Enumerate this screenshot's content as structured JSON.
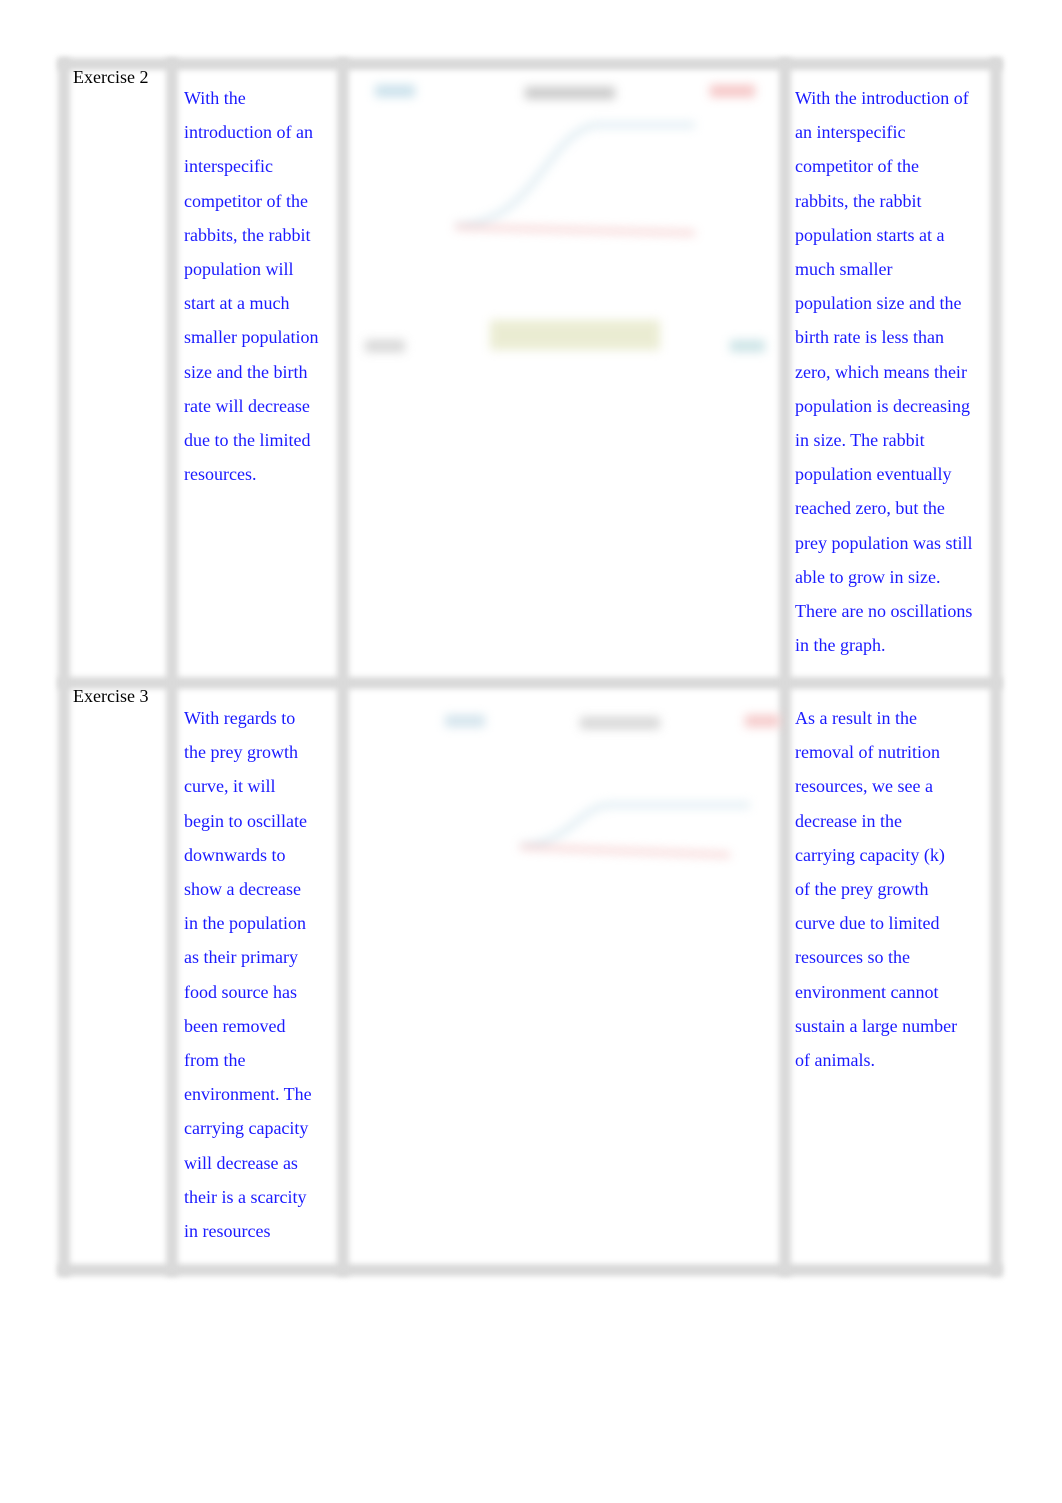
{
  "colors": {
    "text": "#1a1aff",
    "label": "#000000",
    "border": "#d9d9d9"
  },
  "rows": [
    {
      "label": "Exercise 2",
      "prediction": [
        "With the",
        "introduction of an",
        "interspecific",
        "competitor of the",
        "rabbits, the rabbit",
        "population will",
        "start at a much",
        "smaller population",
        "size and the birth",
        "rate will decrease",
        "due to the limited",
        "resources."
      ],
      "result": [
        "With the introduction of",
        "an interspecific",
        "competitor of the",
        "rabbits, the rabbit",
        "population starts at a",
        "much smaller",
        "population size and the",
        "birth rate is less than",
        "zero, which means their",
        "population is decreasing",
        "in size. The rabbit",
        "population eventually",
        "reached zero, but the",
        "prey population was still",
        "able to grow in size.",
        "There are no oscillations",
        "in the graph."
      ]
    },
    {
      "label": "Exercise 3",
      "prediction": [
        "With regards to",
        "the prey growth",
        "curve, it will",
        "begin to oscillate",
        "downwards to",
        "show a decrease",
        "in the population",
        "as their primary",
        "food source has",
        "been removed",
        "from the",
        "environment. The",
        "carrying capacity",
        "will decrease as",
        "their is a scarcity",
        "in resources"
      ],
      "result": [
        "As a result in the",
        "removal of nutrition",
        "resources, we see a",
        "decrease in the",
        "carrying capacity (k)",
        "of the prey growth",
        "curve due to limited",
        "resources so the",
        "environment cannot",
        "sustain a large number",
        "of animals."
      ]
    }
  ]
}
